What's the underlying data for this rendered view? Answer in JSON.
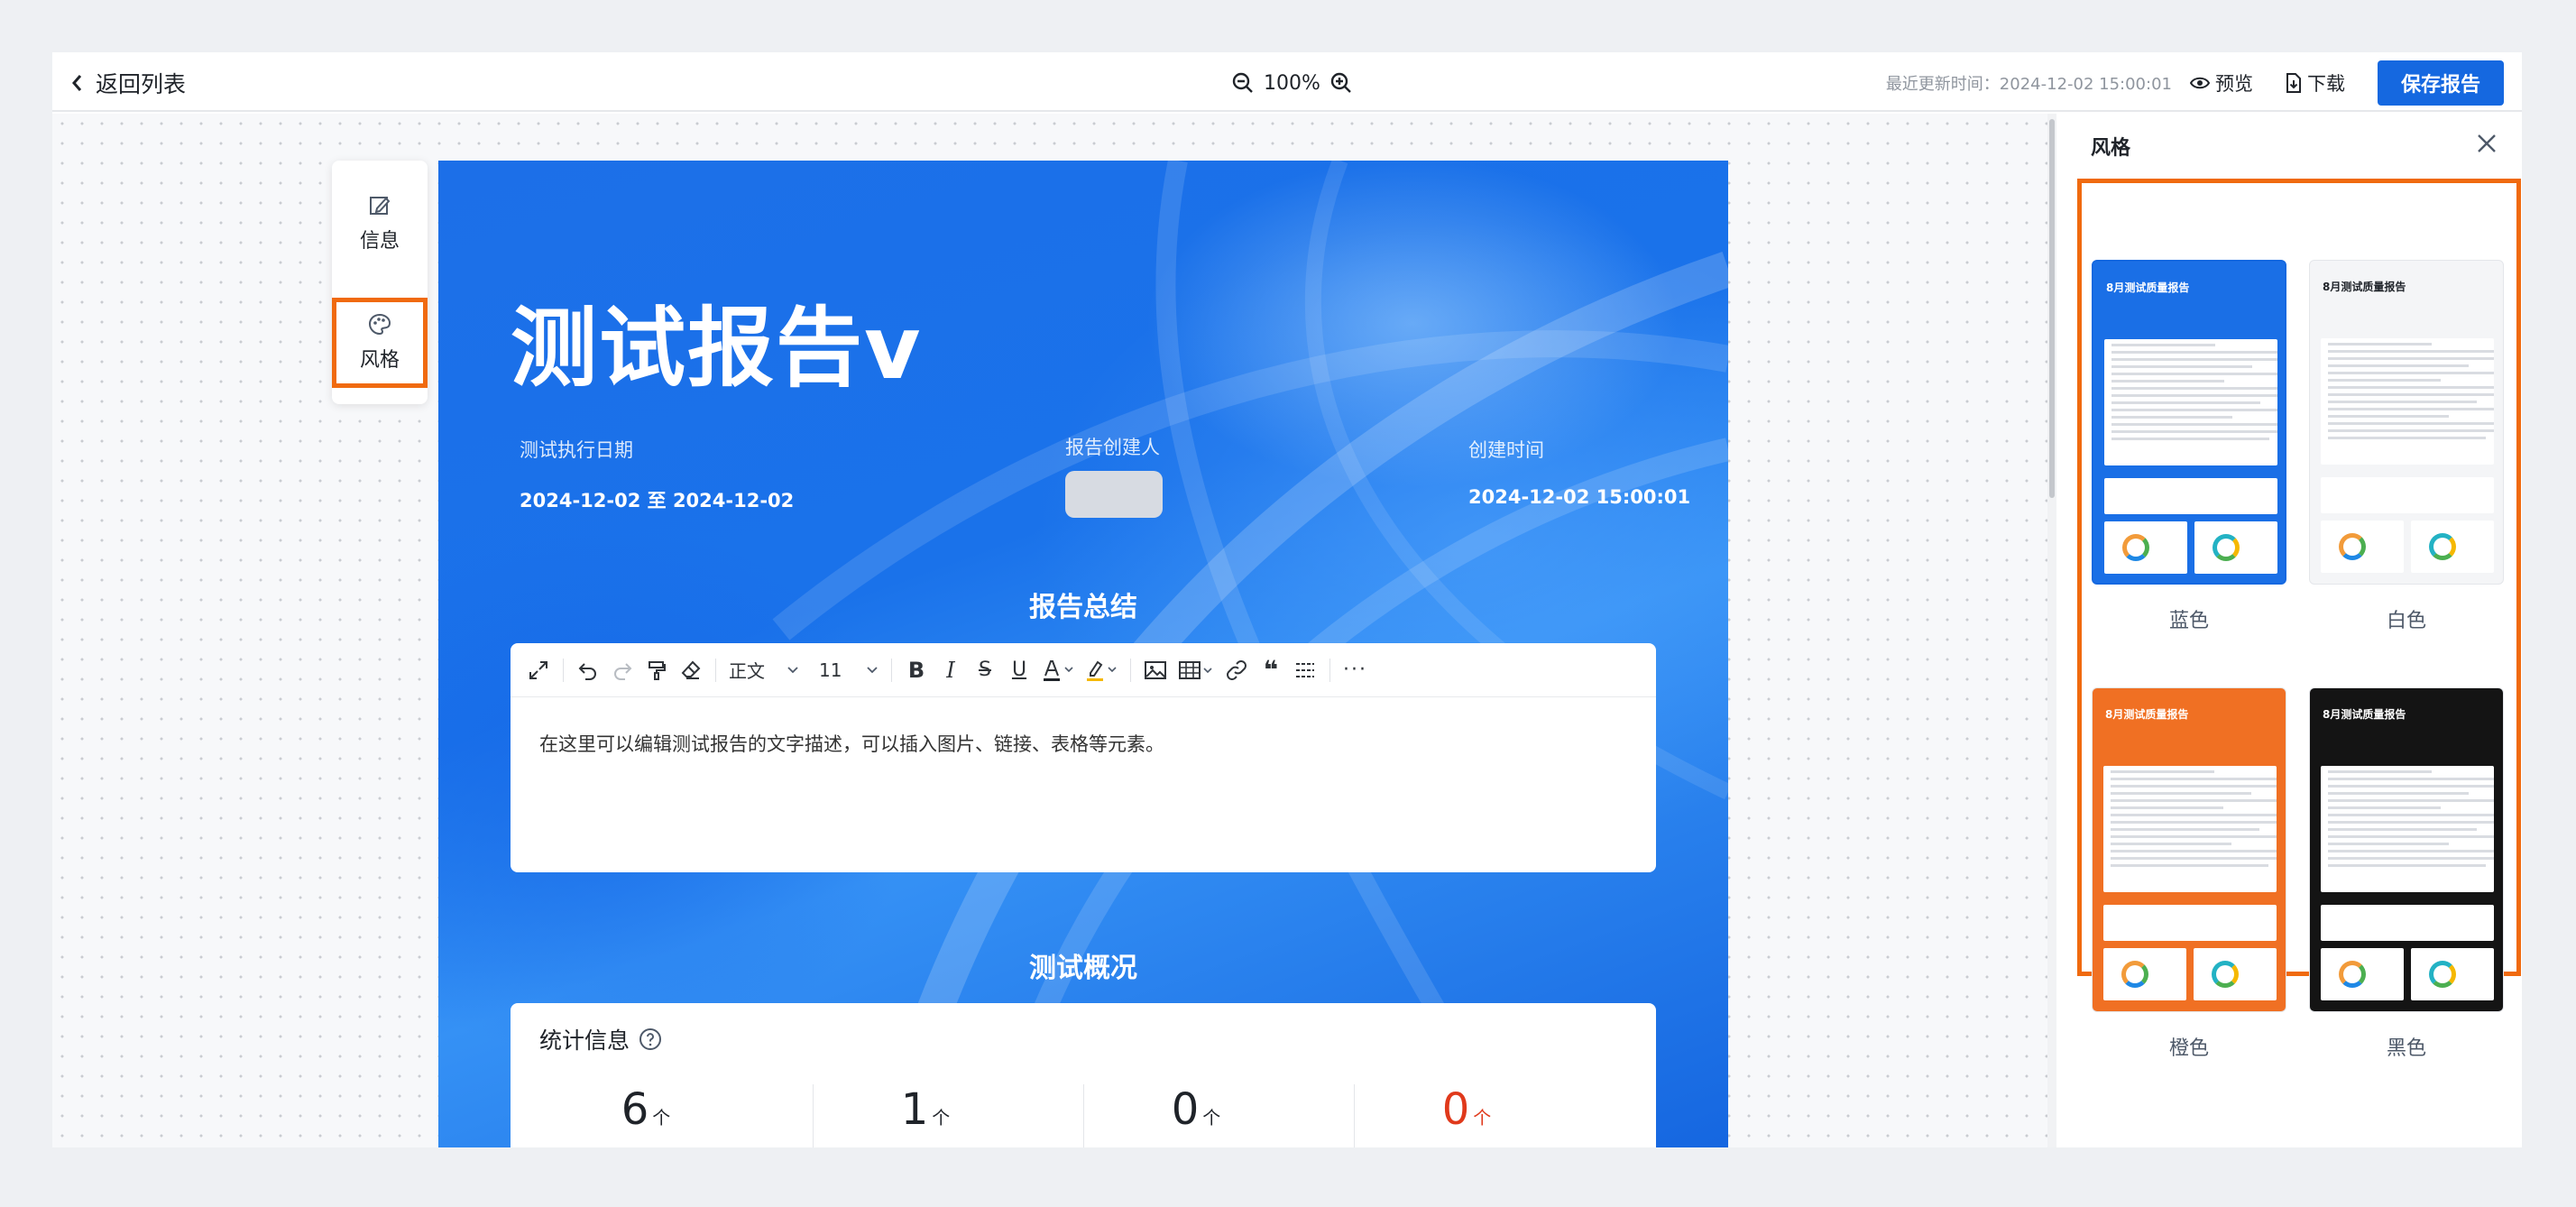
{
  "topbar": {
    "back_label": "返回列表",
    "zoom_value": "100%",
    "updated_text": "最近更新时间：2024-12-02 15:00:01",
    "preview_label": "预览",
    "download_label": "下载",
    "save_label": "保存报告"
  },
  "sidetool": {
    "items": [
      {
        "label": "信息",
        "icon": "edit-icon"
      },
      {
        "label": "风格",
        "icon": "palette-icon"
      }
    ]
  },
  "report": {
    "title": "测试报告v",
    "meta": {
      "exec_date_label": "测试执行日期",
      "exec_date_value": "2024-12-02 至 2024-12-02",
      "creator_label": "报告创建人",
      "created_label": "创建时间",
      "created_value": "2024-12-02 15:00:01"
    },
    "summary_title": "报告总结",
    "editor": {
      "style_value": "正文",
      "size_value": "11",
      "body_text": "在这里可以编辑测试报告的文字描述，可以插入图片、链接、表格等元素。"
    },
    "overview_title": "测试概况",
    "stats": {
      "header": "统计信息",
      "items": [
        {
          "value": "6",
          "unit": "个"
        },
        {
          "value": "1",
          "unit": "个"
        },
        {
          "value": "0",
          "unit": "个"
        },
        {
          "value": "0",
          "unit": "个",
          "color": "#e0391b"
        }
      ]
    }
  },
  "style_panel": {
    "title": "风格",
    "themes": [
      {
        "label": "蓝色",
        "thumb_title": "8月测试质量报告",
        "bg": "#1a6fe6",
        "selected": true
      },
      {
        "label": "白色",
        "thumb_title": "8月测试质量报告",
        "bg": "#f4f5f7",
        "selected": false
      },
      {
        "label": "橙色",
        "thumb_title": "8月测试质量报告",
        "bg": "#f07023",
        "selected": false
      },
      {
        "label": "黑色",
        "thumb_title": "8月测试质量报告",
        "bg": "#141414",
        "selected": false
      }
    ]
  },
  "colors": {
    "accent": "#1568e0",
    "highlight_border": "#f06a0f",
    "negative": "#e0391b"
  }
}
